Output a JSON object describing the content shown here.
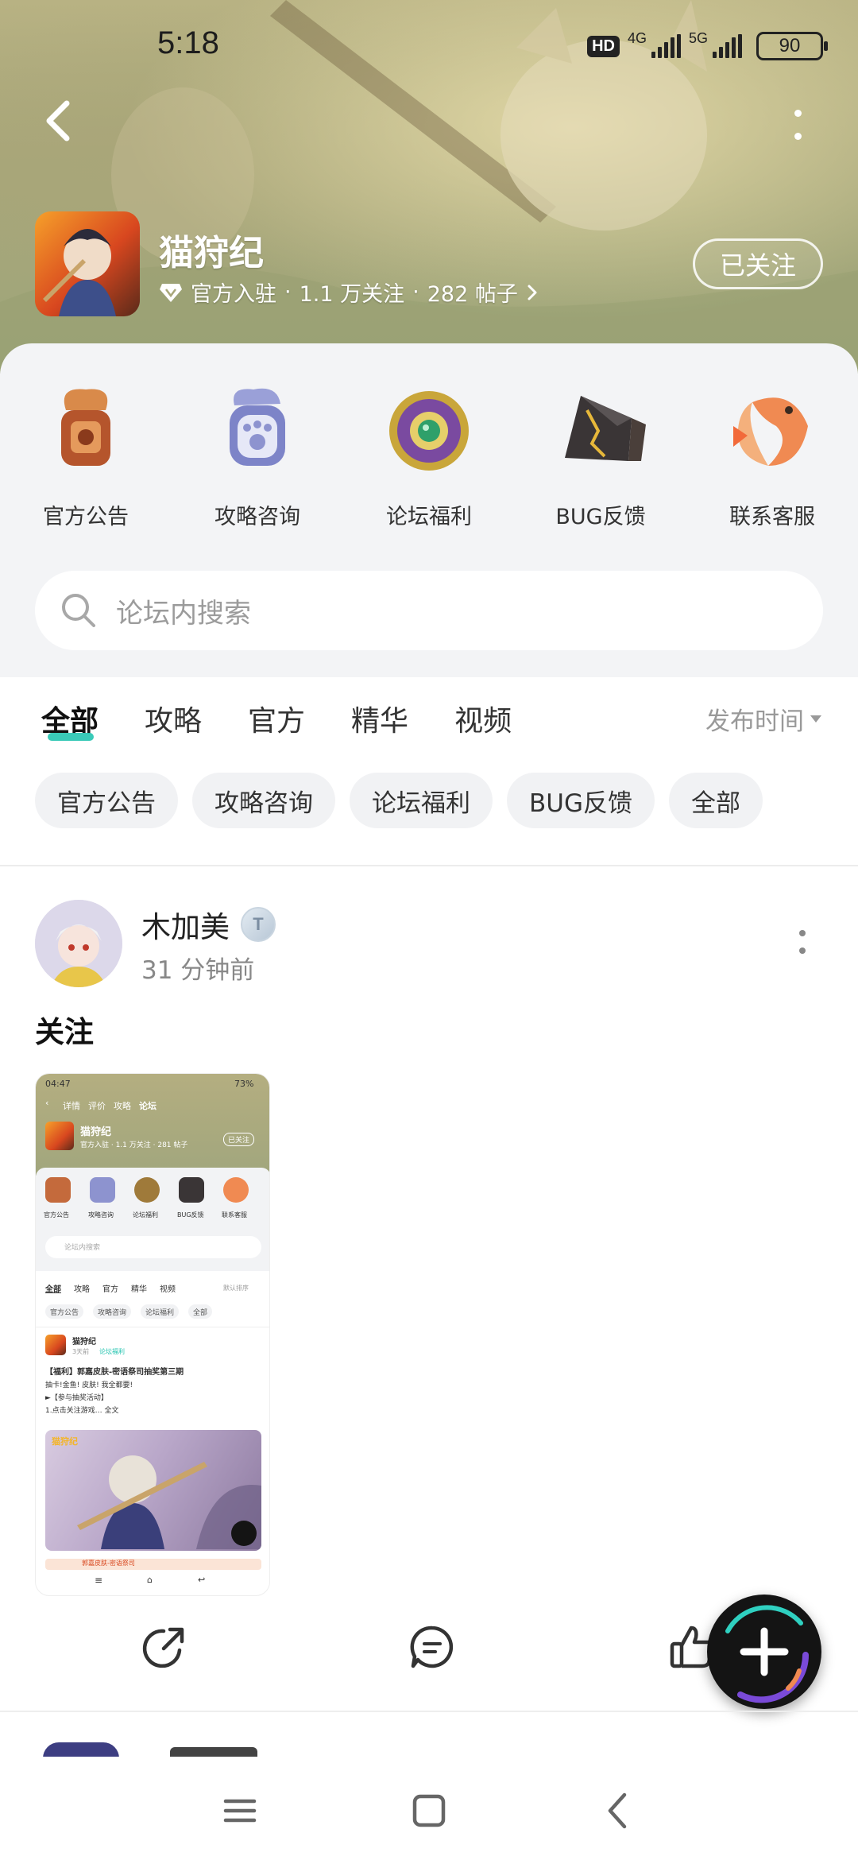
{
  "status_bar": {
    "time": "5:18",
    "hd_badge": "HD",
    "net1": "4G",
    "net2": "5G",
    "battery": "90"
  },
  "forum_header": {
    "game_name": "猫狩纪",
    "official_badge": "官方入驻",
    "followers": "1.1 万关注",
    "posts": "282 帖子",
    "separator": "·",
    "follow_button": "已关注"
  },
  "categories": [
    {
      "label": "官方公告",
      "icon": "seal-icon"
    },
    {
      "label": "攻略咨询",
      "icon": "paw-token-icon"
    },
    {
      "label": "论坛福利",
      "icon": "jade-medallion-icon"
    },
    {
      "label": "BUG反馈",
      "icon": "cracked-stone-icon"
    },
    {
      "label": "联系客服",
      "icon": "koi-fish-icon"
    }
  ],
  "search": {
    "placeholder": "论坛内搜索"
  },
  "tabs": [
    {
      "label": "全部",
      "active": true
    },
    {
      "label": "攻略",
      "active": false
    },
    {
      "label": "官方",
      "active": false
    },
    {
      "label": "精华",
      "active": false
    },
    {
      "label": "视频",
      "active": false
    }
  ],
  "sort_label": "发布时间",
  "filter_chips": [
    "官方公告",
    "攻略咨询",
    "论坛福利",
    "BUG反馈",
    "全部"
  ],
  "post": {
    "author": "木加美",
    "level_badge": "T",
    "time": "31 分钟前",
    "title": "关注",
    "thumbnail": {
      "time": "04:47",
      "battery": "73%",
      "nav_tabs": [
        "详情",
        "评价",
        "攻略",
        "论坛"
      ],
      "game_name": "猫狩纪",
      "meta": "官方入驻 · 1.1 万关注 · 281 帖子",
      "follow": "已关注",
      "cat_labels": [
        "官方公告",
        "攻略咨询",
        "论坛福利",
        "BUG反馈",
        "联系客服"
      ],
      "search": "论坛内搜索",
      "tabs": [
        "全部",
        "攻略",
        "官方",
        "精华",
        "视频"
      ],
      "sort": "默认排序",
      "chips": [
        "官方公告",
        "攻略咨询",
        "论坛福利",
        "全部"
      ],
      "post_author": "猫狩纪",
      "post_time": "3天前",
      "post_tag": "论坛福利",
      "post_title": "【福利】郭嘉皮肤-密语祭司抽奖第三期",
      "post_line1": "抽卡!金鱼! 皮肤! 我全都要!",
      "post_line2": "►【参与抽奖活动】",
      "post_line3": "1.点击关注游戏… 全文",
      "poster_logo": "猫狩纪",
      "bottom_tag": "郭嘉皮肤-密语祭司"
    }
  },
  "actions": [
    {
      "name": "share",
      "icon": "share-icon"
    },
    {
      "name": "comment",
      "icon": "comment-icon"
    },
    {
      "name": "like",
      "icon": "thumbs-up-icon"
    }
  ],
  "colors": {
    "accent": "#25c4b0",
    "header_bg": "#a8a77a",
    "panel_bg": "#f3f4f6"
  }
}
